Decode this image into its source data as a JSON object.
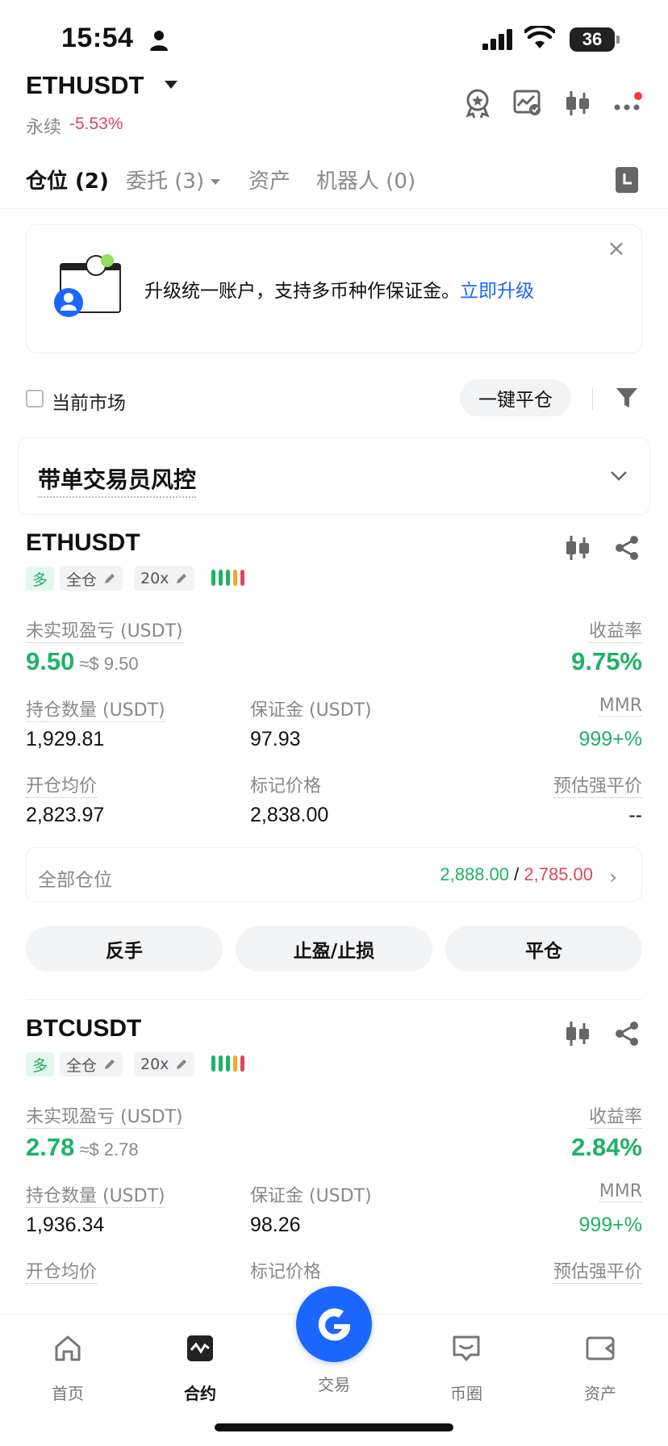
{
  "status_bar": {
    "time": "15:54",
    "battery": "36"
  },
  "header": {
    "symbol": "ETHUSDT",
    "contract_type": "永续",
    "change": "-5.53%",
    "icons": [
      "award-icon",
      "chart-check-icon",
      "candlestick-icon",
      "more-icon"
    ]
  },
  "tabs": [
    {
      "label": "仓位 (2)",
      "active": true
    },
    {
      "label": "委托 (3)",
      "active": false
    },
    {
      "label": "资产",
      "active": false
    },
    {
      "label": "机器人 (0)",
      "active": false
    }
  ],
  "banner": {
    "text": "升级统一账户，支持多币种作保证金。",
    "link": "立即升级",
    "close": "×"
  },
  "filter": {
    "current_market": "当前市场",
    "close_all": "一键平仓"
  },
  "risk": {
    "title": "带单交易员风控"
  },
  "colors": {
    "green": "#1eb265",
    "red": "#e0455e",
    "blue": "#1a66ff"
  },
  "positions": [
    {
      "symbol": "ETHUSDT",
      "side": "多",
      "margin_mode": "全仓",
      "leverage": "20x",
      "unrealized_label": "未实现盈亏 (USDT)",
      "unrealized": "9.50",
      "unrealized_approx": "≈$ 9.50",
      "roe_label": "收益率",
      "roe": "9.75%",
      "size_label": "持仓数量 (USDT)",
      "size": "1,929.81",
      "margin_label": "保证金 (USDT)",
      "margin": "97.93",
      "mmr_label": "MMR",
      "mmr": "999+%",
      "entry_label": "开仓均价",
      "entry": "2,823.97",
      "mark_label": "标记价格",
      "mark": "2,838.00",
      "liq_label": "预估强平价",
      "liq": "--",
      "all_label": "全部仓位",
      "tp": "2,888.00",
      "sl": "2,785.00",
      "btn_reverse": "反手",
      "btn_tpsl": "止盈/止损",
      "btn_close": "平仓"
    },
    {
      "symbol": "BTCUSDT",
      "side": "多",
      "margin_mode": "全仓",
      "leverage": "20x",
      "unrealized_label": "未实现盈亏 (USDT)",
      "unrealized": "2.78",
      "unrealized_approx": "≈$ 2.78",
      "roe_label": "收益率",
      "roe": "2.84%",
      "size_label": "持仓数量 (USDT)",
      "size": "1,936.34",
      "margin_label": "保证金 (USDT)",
      "margin": "98.26",
      "mmr_label": "MMR",
      "mmr": "999+%",
      "entry_label": "开仓均价",
      "mark_label": "标记价格",
      "liq_label": "预估强平价"
    }
  ],
  "bottom_nav": [
    {
      "label": "首页",
      "icon": "home-icon"
    },
    {
      "label": "合约",
      "icon": "futures-icon"
    },
    {
      "label": "交易",
      "icon": "trade-icon"
    },
    {
      "label": "币圈",
      "icon": "community-icon"
    },
    {
      "label": "资产",
      "icon": "wallet-icon"
    }
  ]
}
